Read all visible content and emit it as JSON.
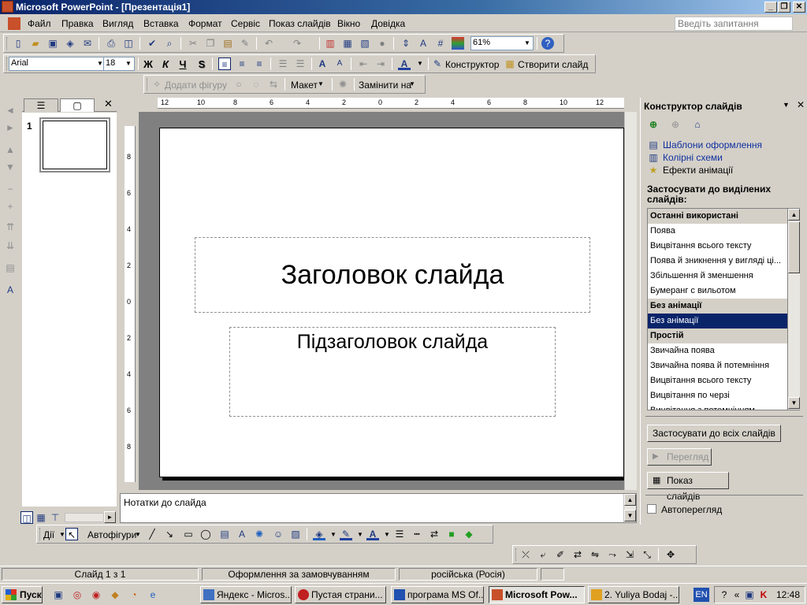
{
  "window": {
    "title": "Microsoft PowerPoint - [Презентація1]"
  },
  "menu": {
    "items": [
      "Файл",
      "Правка",
      "Вигляд",
      "Вставка",
      "Формат",
      "Сервіс",
      "Показ слайдів",
      "Вікно",
      "Довідка"
    ],
    "help_placeholder": "Введіть запитання"
  },
  "standard_toolbar": {
    "zoom": "61%"
  },
  "format_toolbar": {
    "font": "Arial",
    "size": "18",
    "bold": "Ж",
    "italic": "К",
    "underline": "Ч",
    "shadow": "S",
    "designer": "Конструктор",
    "new_slide": "Створити слайд"
  },
  "diagram_toolbar": {
    "add_shape": "Додати фігуру",
    "layout": "Макет",
    "replace": "Замінити на"
  },
  "outline": {
    "slide_number": "1"
  },
  "ruler": {
    "h_ticks": [
      "12",
      "10",
      "8",
      "6",
      "4",
      "2",
      "0",
      "2",
      "4",
      "6",
      "8",
      "10",
      "12"
    ],
    "v_ticks": [
      "8",
      "6",
      "4",
      "2",
      "0",
      "2",
      "4",
      "6",
      "8"
    ]
  },
  "slide": {
    "title": "Заголовок слайда",
    "subtitle": "Підзаголовок слайда"
  },
  "notes": {
    "placeholder": "Нотатки до слайда"
  },
  "taskpane": {
    "title": "Конструктор слайдів",
    "links": [
      "Шаблони оформлення",
      "Колірні схеми",
      "Ефекти анімації"
    ],
    "apply_label": "Застосувати до виділених слайдів:",
    "list": [
      {
        "text": "Останні використані",
        "type": "header"
      },
      {
        "text": "Поява",
        "type": "item"
      },
      {
        "text": "Вицвітання всього тексту",
        "type": "item"
      },
      {
        "text": "Поява й зникнення у вигляді ці...",
        "type": "item"
      },
      {
        "text": "Збільшення й зменшення",
        "type": "item"
      },
      {
        "text": "Бумеранг с вильотом",
        "type": "item"
      },
      {
        "text": "Без анімації",
        "type": "header"
      },
      {
        "text": "Без анімації",
        "type": "selected"
      },
      {
        "text": "Простій",
        "type": "header"
      },
      {
        "text": "Звичайна поява",
        "type": "item"
      },
      {
        "text": "Звичайна поява й потемніння",
        "type": "item"
      },
      {
        "text": "Вицвітання всього тексту",
        "type": "item"
      },
      {
        "text": "Вицвітання по черзі",
        "type": "item"
      },
      {
        "text": "Вицвітання з потемнінням",
        "type": "item"
      }
    ],
    "apply_all": "Застосувати до всіх слайдів",
    "preview": "Перегляд",
    "slideshow": "Показ слайдів",
    "autopreview": "Автоперегляд"
  },
  "draw_toolbar": {
    "actions": "Дії",
    "autoshapes": "Автофігури"
  },
  "statusbar": {
    "slide": "Слайд 1 з 1",
    "design": "Оформлення за замовчуванням",
    "language": "російська (Росія)"
  },
  "taskbar": {
    "start": "Пуск",
    "tasks": [
      "Яндекс - Micros...",
      "Пустая страни...",
      "програма MS Of...",
      "Microsoft Pow...",
      "2. Yuliya Bodaj -..."
    ],
    "lang": "EN",
    "clock": "12:48"
  },
  "colors": {
    "title_gradient_start": "#0a246a",
    "selection": "#0a246a",
    "link": "#1030a0"
  }
}
